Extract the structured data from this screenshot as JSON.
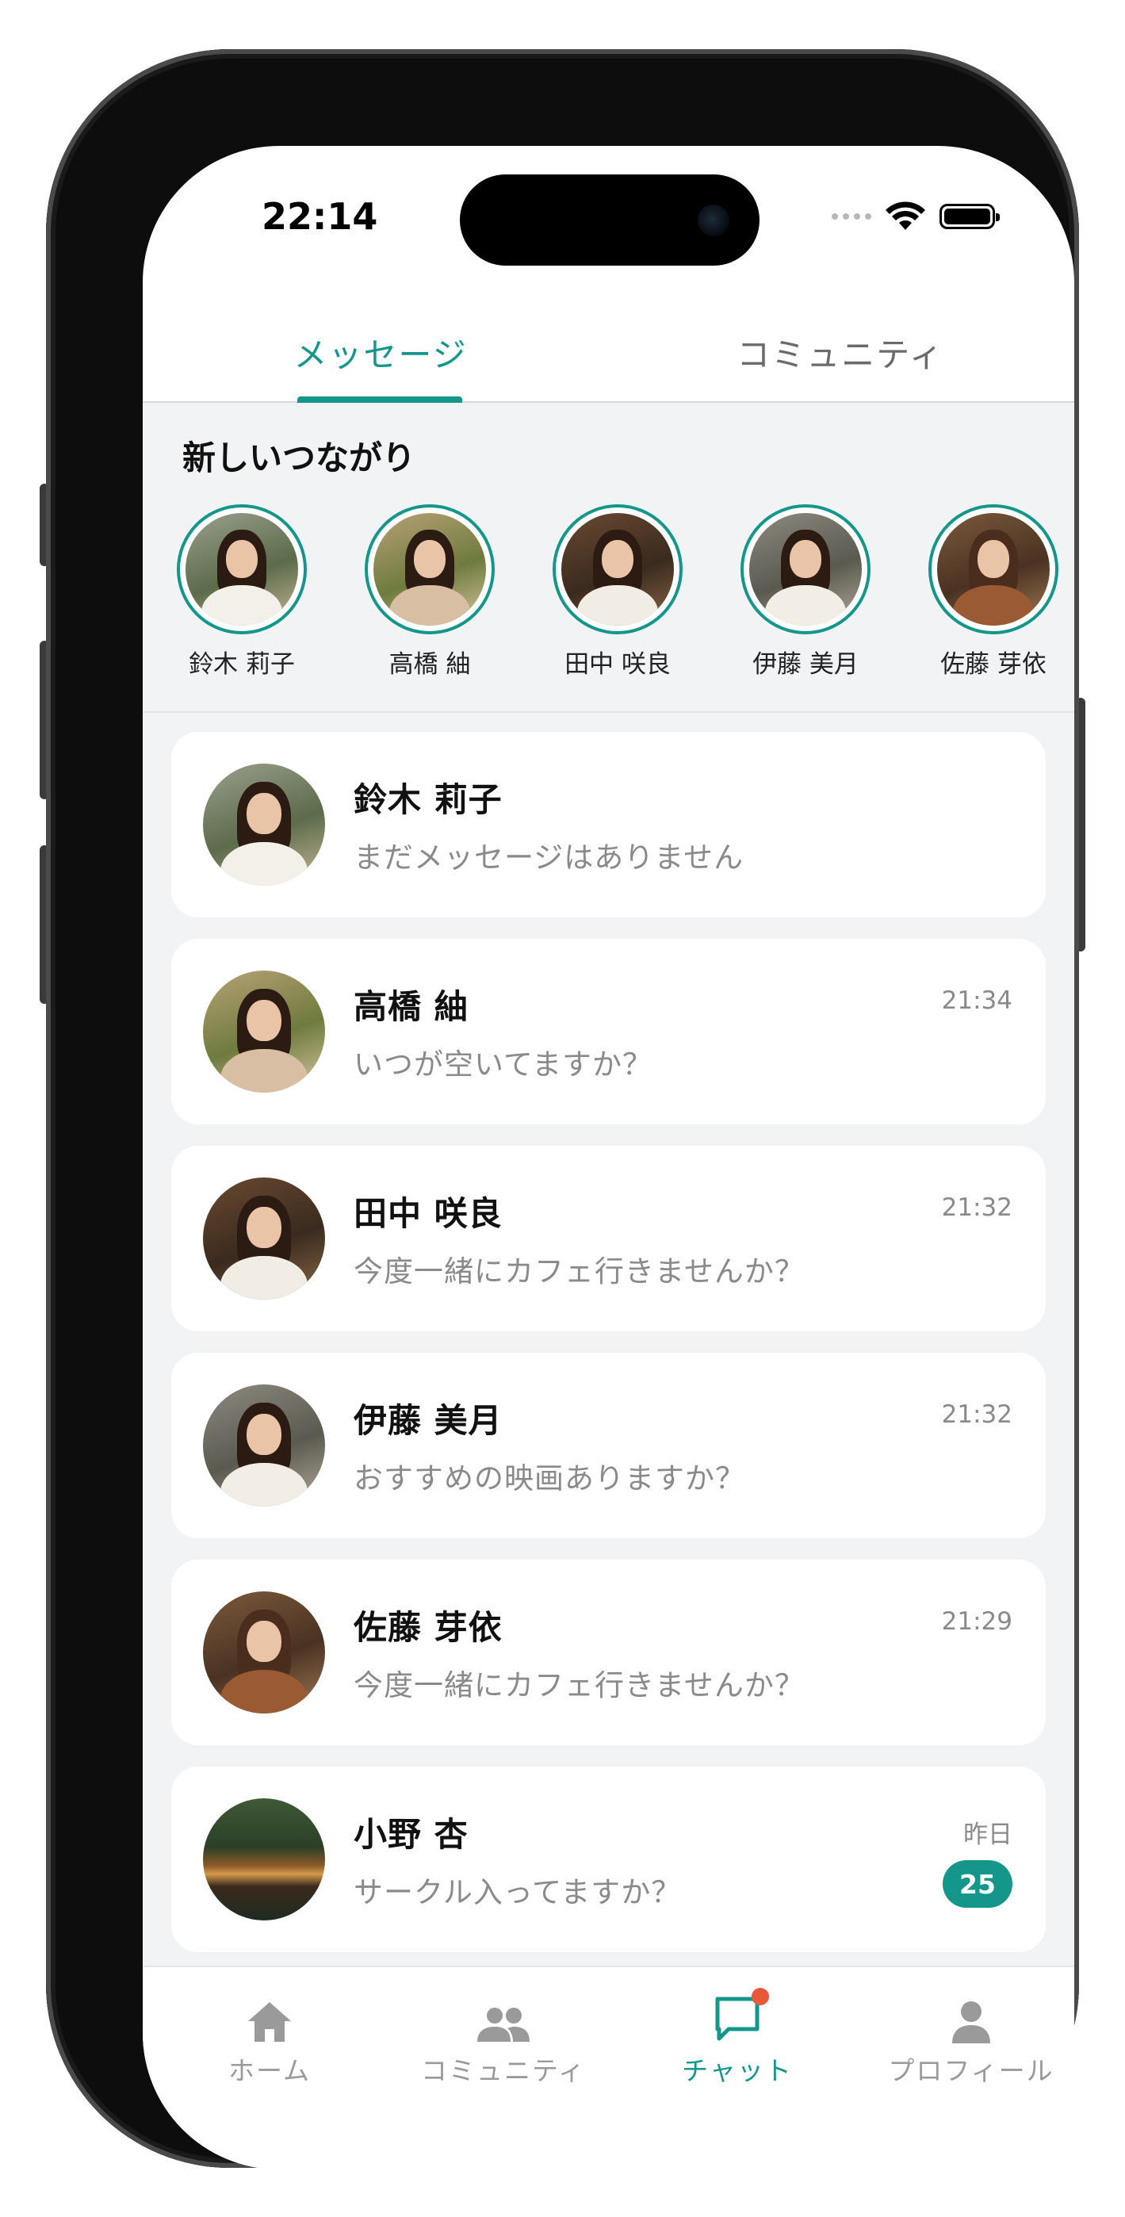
{
  "status_bar": {
    "time": "22:14"
  },
  "tabs": [
    {
      "label": "メッセージ",
      "active": true
    },
    {
      "label": "コミュニティ",
      "active": false
    }
  ],
  "connections": {
    "title": "新しいつながり",
    "people": [
      {
        "name": "鈴木 莉子"
      },
      {
        "name": "高橋 紬"
      },
      {
        "name": "田中 咲良"
      },
      {
        "name": "伊藤 美月"
      },
      {
        "name": "佐藤 芽依"
      }
    ]
  },
  "chats": [
    {
      "name": "鈴木 莉子",
      "message": "まだメッセージはありません",
      "time": ""
    },
    {
      "name": "高橋 紬",
      "message": "いつが空いてますか？",
      "time": "21:34"
    },
    {
      "name": "田中 咲良",
      "message": "今度一緒にカフェ行きませんか？",
      "time": "21:32"
    },
    {
      "name": "伊藤 美月",
      "message": "おすすめの映画ありますか？",
      "time": "21:32"
    },
    {
      "name": "佐藤 芽依",
      "message": "今度一緒にカフェ行きませんか？",
      "time": "21:29"
    },
    {
      "name": "小野 杏",
      "message": "サークル入ってますか？",
      "time": "昨日",
      "unread": "25"
    }
  ],
  "bottom_nav": [
    {
      "label": "ホーム",
      "icon": "home-icon"
    },
    {
      "label": "コミュニティ",
      "icon": "people-icon"
    },
    {
      "label": "チャット",
      "icon": "chat-icon",
      "active": true
    },
    {
      "label": "プロフィール",
      "icon": "person-icon"
    }
  ],
  "colors": {
    "accent": "#14968a",
    "notify": "#e8583a",
    "background": "#f2f3f4"
  }
}
